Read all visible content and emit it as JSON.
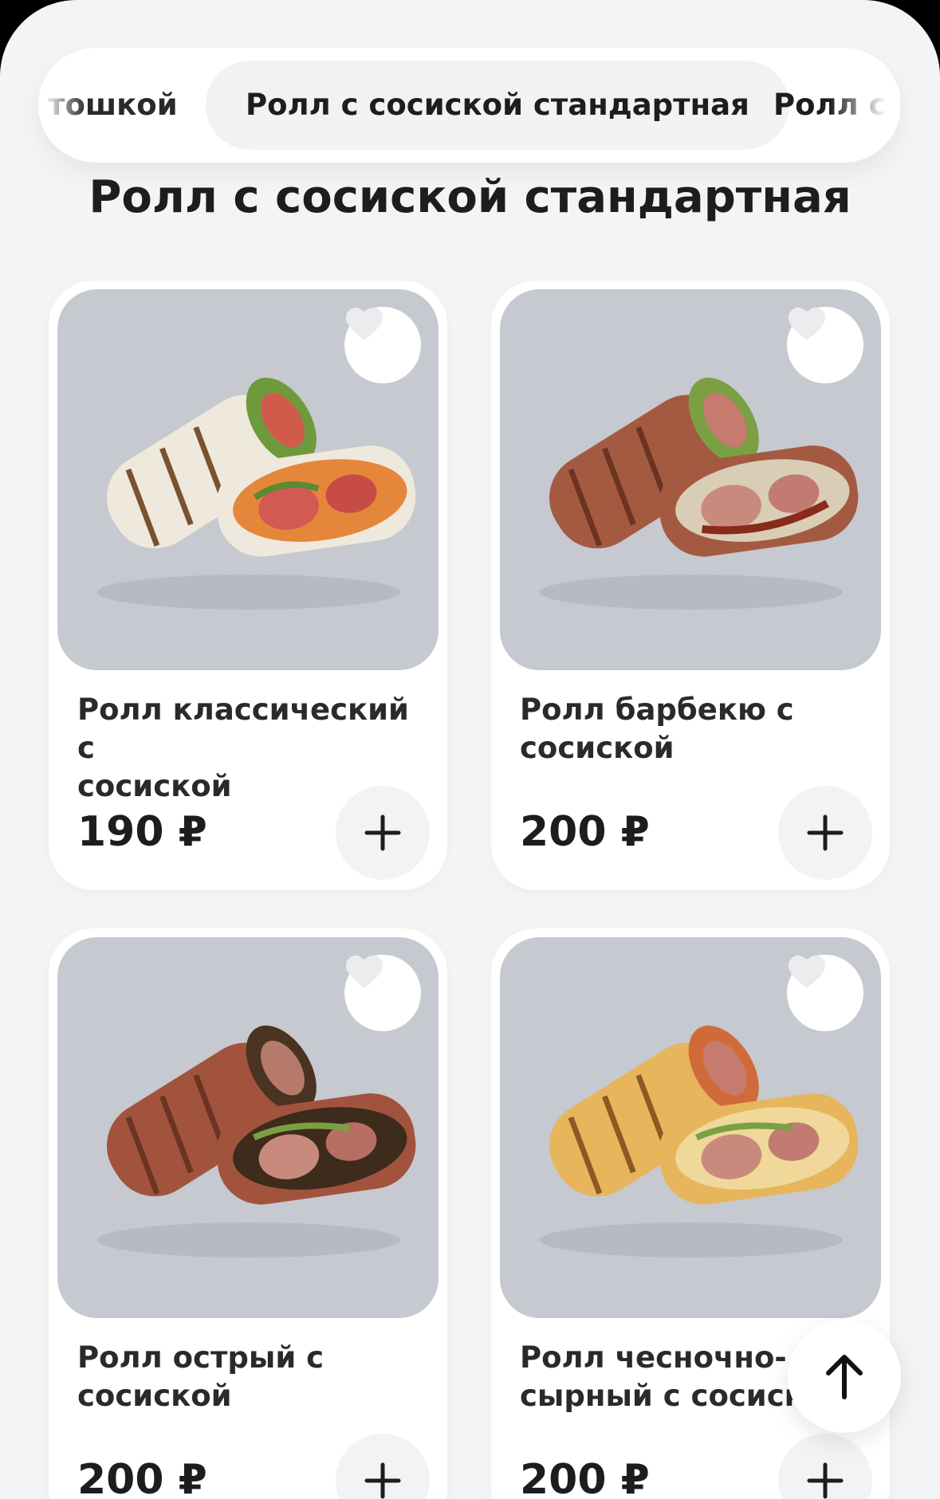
{
  "tabs": {
    "items": [
      {
        "label": "тошкой"
      },
      {
        "label": "Ролл с сосиской стандартная",
        "active": true
      },
      {
        "label": "Ролл с с"
      }
    ]
  },
  "section": {
    "title": "Ролл с сосиской стандартная"
  },
  "products": [
    {
      "name": "Ролл классический с\nсосиской",
      "price": "190 ₽",
      "wrap_color": "#efe8dc"
    },
    {
      "name": "Ролл барбекю  с\nсосиской",
      "price": "200 ₽",
      "wrap_color": "#a45a41"
    },
    {
      "name": "Ролл острый  с\nсосиской",
      "price": "200 ₽",
      "wrap_color": "#a2533d"
    },
    {
      "name": "Ролл чесночно-\nсырный с сосиско",
      "price": "200 ₽",
      "wrap_color": "#e6b55c"
    }
  ],
  "icons": {
    "favorite": "heart-icon",
    "add": "plus-icon",
    "scroll_top": "arrow-up-icon"
  },
  "colors": {
    "background": "#f4f4f6",
    "card": "#ffffff",
    "text": "#1d1d1f"
  }
}
